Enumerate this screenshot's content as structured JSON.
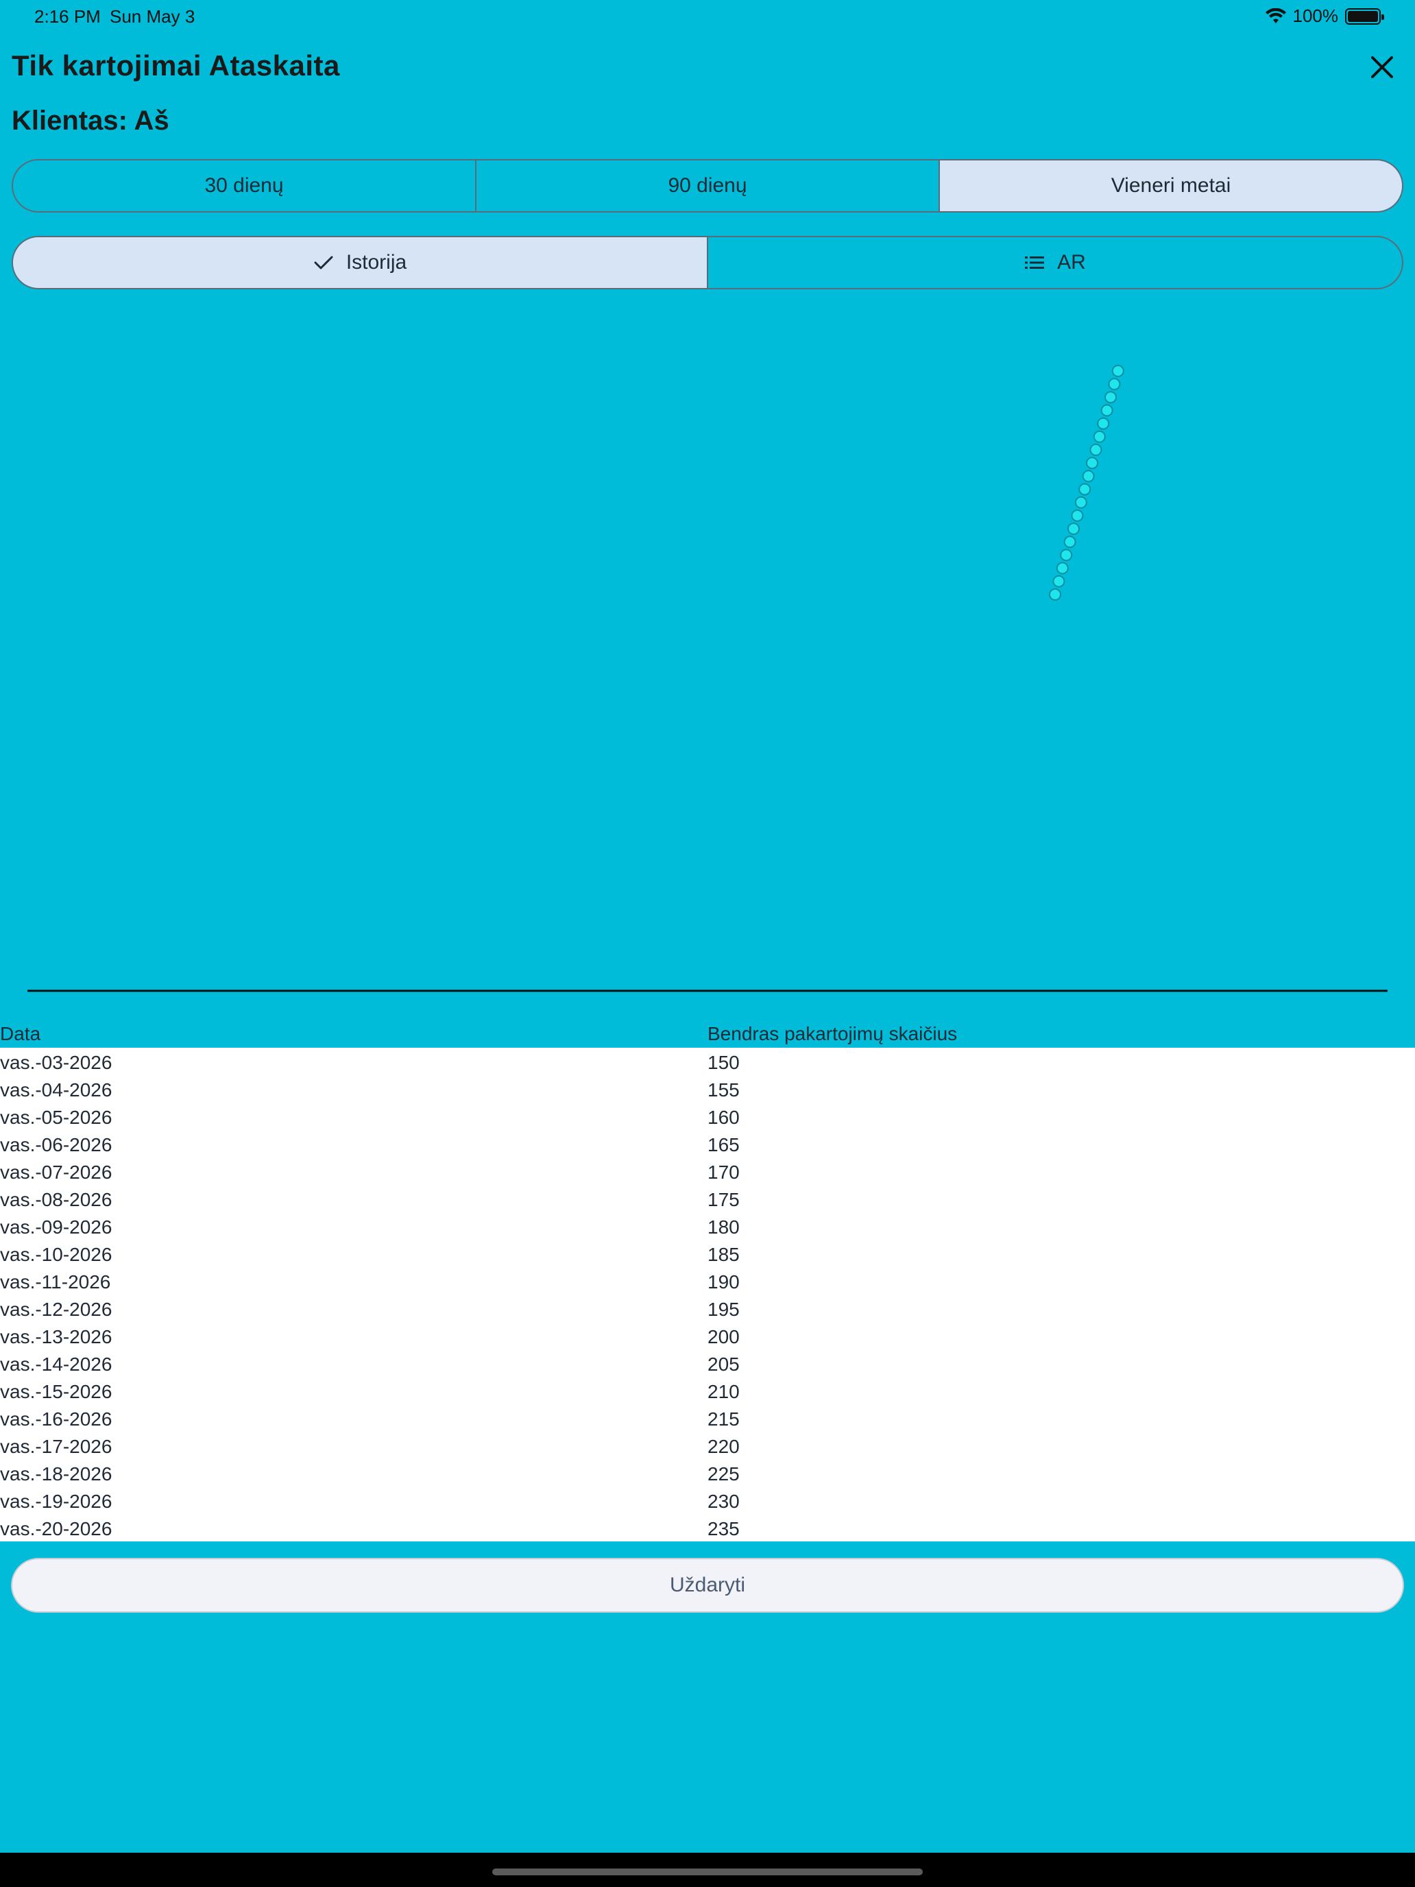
{
  "status_bar": {
    "time": "2:16 PM",
    "date": "Sun May 3",
    "battery": "100%",
    "icons": [
      "wifi-icon",
      "battery-icon"
    ]
  },
  "header": {
    "title": "Tik kartojimai Ataskaita",
    "client_label": "Klientas: Aš",
    "close_icon": "close-icon"
  },
  "period_tabs": [
    {
      "label": "30 dienų",
      "selected": false
    },
    {
      "label": "90 dienų",
      "selected": false
    },
    {
      "label": "Vieneri metai",
      "selected": true
    }
  ],
  "view_tabs": [
    {
      "label": "Istorija",
      "icon": "check-icon",
      "selected": true
    },
    {
      "label": "AR",
      "icon": "list-icon",
      "selected": false
    }
  ],
  "chart_data": {
    "type": "scatter",
    "x": [
      "vas.-03-2026",
      "vas.-04-2026",
      "vas.-05-2026",
      "vas.-06-2026",
      "vas.-07-2026",
      "vas.-08-2026",
      "vas.-09-2026",
      "vas.-10-2026",
      "vas.-11-2026",
      "vas.-12-2026",
      "vas.-13-2026",
      "vas.-14-2026",
      "vas.-15-2026",
      "vas.-16-2026",
      "vas.-17-2026",
      "vas.-18-2026",
      "vas.-19-2026",
      "vas.-20-2026"
    ],
    "values": [
      150,
      155,
      160,
      165,
      170,
      175,
      180,
      185,
      190,
      195,
      200,
      205,
      210,
      215,
      220,
      225,
      230,
      235
    ],
    "title": "",
    "xlabel": "",
    "ylabel": "",
    "grid": false,
    "point_color": "#1ee6ec",
    "axis_color": "#111111"
  },
  "table": {
    "headers": [
      "Data",
      "Bendras pakartojimų skaičius"
    ],
    "rows": [
      [
        "vas.-03-2026",
        "150"
      ],
      [
        "vas.-04-2026",
        "155"
      ],
      [
        "vas.-05-2026",
        "160"
      ],
      [
        "vas.-06-2026",
        "165"
      ],
      [
        "vas.-07-2026",
        "170"
      ],
      [
        "vas.-08-2026",
        "175"
      ],
      [
        "vas.-09-2026",
        "180"
      ],
      [
        "vas.-10-2026",
        "185"
      ],
      [
        "vas.-11-2026",
        "190"
      ],
      [
        "vas.-12-2026",
        "195"
      ],
      [
        "vas.-13-2026",
        "200"
      ],
      [
        "vas.-14-2026",
        "205"
      ],
      [
        "vas.-15-2026",
        "210"
      ],
      [
        "vas.-16-2026",
        "215"
      ],
      [
        "vas.-17-2026",
        "220"
      ],
      [
        "vas.-18-2026",
        "225"
      ],
      [
        "vas.-19-2026",
        "230"
      ],
      [
        "vas.-20-2026",
        "235"
      ]
    ]
  },
  "footer": {
    "close_label": "Uždaryti"
  },
  "colors": {
    "background": "#00bcd8",
    "selected_segment": "#d6e4f6",
    "table_background": "#ffffff",
    "button_background": "#f1f3f9"
  }
}
